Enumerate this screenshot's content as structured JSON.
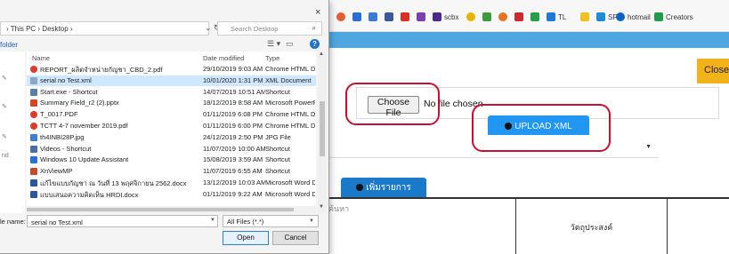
{
  "bookmarks": [
    {
      "label": "",
      "icon": "chrome-extension-icon",
      "color": "#e65c2e"
    },
    {
      "label": "",
      "icon": "blue-square-icon",
      "color": "#2a6fd6"
    },
    {
      "label": "",
      "icon": "calendar-24-icon",
      "color": "#3b7bd4"
    },
    {
      "label": "",
      "icon": "facebook-icon",
      "color": "#3b5998"
    },
    {
      "label": "",
      "icon": "gmail-icon",
      "color": "#d93025"
    },
    {
      "label": "",
      "icon": "purple-square-icon",
      "color": "#7b3fb0"
    },
    {
      "label": "scbx",
      "icon": "scbx-icon",
      "color": "#4b2b8a"
    },
    {
      "label": "",
      "icon": "smiley-icon",
      "color": "#e8b400"
    },
    {
      "label": "",
      "icon": "leaf-icon",
      "color": "#3f9b3f"
    },
    {
      "label": "",
      "icon": "orange-circle-icon",
      "color": "#e6731f"
    },
    {
      "label": "",
      "icon": "red-square-icon",
      "color": "#cc2b2b"
    },
    {
      "label": "",
      "icon": "green-square-icon",
      "color": "#2a9d4a"
    },
    {
      "label": "TL",
      "icon": "tl-icon",
      "color": "#1e7ad6"
    },
    {
      "label": "",
      "icon": "yellow-square-icon",
      "color": "#f0c020"
    },
    {
      "label": "SF",
      "icon": "sf-icon",
      "color": "#1f8ad6"
    },
    {
      "label": "hotmail",
      "icon": "outlook-icon",
      "color": "#0a64c4"
    },
    {
      "label": "Creators",
      "icon": "creators-icon",
      "color": "#1f9d4a"
    }
  ],
  "page": {
    "close_label": "Close",
    "choose_file_label": "Choose File",
    "file_status": "No file chosen",
    "upload_label": "UPLOAD XML",
    "select_arrow": "▼",
    "add_tab_label": "เพิ่มรายการ",
    "grid_col1": "ค้นหา",
    "grid_col2": "วัตถุประสงค์"
  },
  "dialog": {
    "close_glyph": "×",
    "address": "› This PC › Desktop ›",
    "search_placeholder": "Search Desktop",
    "folder_label": "folder",
    "columns": {
      "name": "Name",
      "date": "Date modified",
      "type": "Type"
    },
    "files": [
      {
        "name": "REPORT_ผลิตจำหน่ายกัญชา_CBD_2.pdf",
        "date": "29/10/2019 9:03 AM",
        "type": "Chrome HTML Docu...",
        "icon": "chrome-icon",
        "color": "#dd3b2c",
        "selected": false
      },
      {
        "name": "serial no Test.xml",
        "date": "10/01/2020 1:31 PM",
        "type": "XML Document",
        "icon": "xml-file-icon",
        "color": "#8aa7c6",
        "selected": true
      },
      {
        "name": "Start.exe - Shortcut",
        "date": "14/07/2019 10:51 AM",
        "type": "Shortcut",
        "icon": "shortcut-icon",
        "color": "#5a7fa6",
        "selected": false
      },
      {
        "name": "Summary Field_r2 (2).pptx",
        "date": "18/12/2019 8:58 AM",
        "type": "Microsoft PowerPoint...",
        "icon": "powerpoint-icon",
        "color": "#d24726",
        "selected": false
      },
      {
        "name": "T_0017.PDF",
        "date": "01/11/2019 6:08 PM",
        "type": "Chrome HTML Docu...",
        "icon": "chrome-icon",
        "color": "#dd3b2c",
        "selected": false
      },
      {
        "name": "TCTT 4-7 november 2019.pdf",
        "date": "01/11/2019 6:00 PM",
        "type": "Chrome HTML Docu...",
        "icon": "chrome-icon",
        "color": "#dd3b2c",
        "selected": false
      },
      {
        "name": "th4INBI28P.jpg",
        "date": "24/12/2019 2:50 PM",
        "type": "JPG File",
        "icon": "image-file-icon",
        "color": "#3f7ccf",
        "selected": false
      },
      {
        "name": "Videos - Shortcut",
        "date": "11/07/2019 10:00 AM",
        "type": "Shortcut",
        "icon": "video-shortcut-icon",
        "color": "#4a6fa5",
        "selected": false
      },
      {
        "name": "Windows 10 Update Assistant",
        "date": "15/08/2019 3:59 AM",
        "type": "Shortcut",
        "icon": "windows-icon",
        "color": "#2b6fd8",
        "selected": false
      },
      {
        "name": "XnViewMP",
        "date": "11/07/2019 6:55 AM",
        "type": "Shortcut",
        "icon": "xnview-icon",
        "color": "#c84a2a",
        "selected": false
      },
      {
        "name": "แก้ไขแบบกัญชา ณ วันที่ 13 พฤศจิกายน 2562.docx",
        "date": "13/12/2019 10:03 AM",
        "type": "Microsoft Word Docu...",
        "icon": "word-icon",
        "color": "#2b579a",
        "selected": false
      },
      {
        "name": "แบบเสนอความคิดเห็น HRDI.docx",
        "date": "01/11/2019 9:22 AM",
        "type": "Microsoft Word Docu...",
        "icon": "word-icon",
        "color": "#2b579a",
        "selected": false
      }
    ],
    "file_name_label": "le name:",
    "file_name_value": "serial no Test.xml",
    "filter_value": "All Files (*.*)",
    "open_label": "Open",
    "cancel_label": "Cancel"
  },
  "colors": {
    "annotation": "#c8102e",
    "accent_blue": "#2196f3",
    "close_yellow": "#f2b21a"
  }
}
